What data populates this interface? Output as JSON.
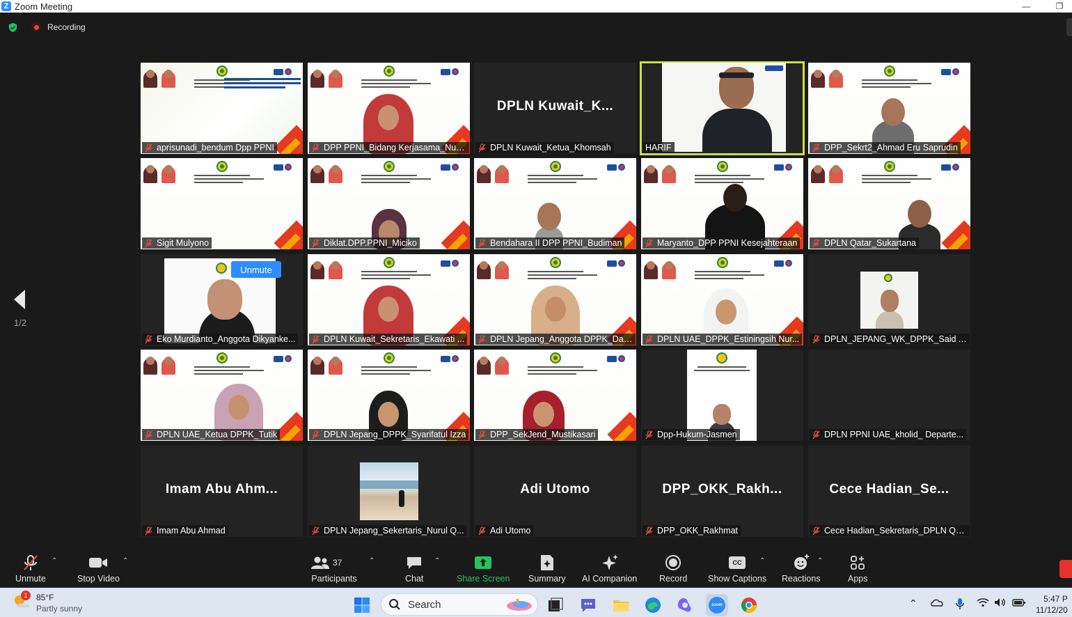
{
  "window": {
    "title": "Zoom Meeting",
    "minimize_glyph": "—",
    "restore_glyph": "❐"
  },
  "status": {
    "recording_label": "Recording"
  },
  "pagination": {
    "page_label": "1/2"
  },
  "tiles": [
    {
      "name": "aprisunadi_bendum Dpp PPNI",
      "kind": "slide-green"
    },
    {
      "name": "DPP PPNI_Bidang Kerjasama_Nuni...",
      "kind": "slide-hijab"
    },
    {
      "name": "DPLN Kuwait_Ketua_Khomsah",
      "kind": "avatar",
      "display": "DPLN  Kuwait_K..."
    },
    {
      "name": "HARIF",
      "kind": "speaker"
    },
    {
      "name": "DPP_Sekrt2_Ahmad Eru Saprudin",
      "kind": "slide-man"
    },
    {
      "name": "Sigit Mulyono",
      "kind": "slide"
    },
    {
      "name": "Diklat.DPP.PPNI_Miciko",
      "kind": "slide-hijab-small"
    },
    {
      "name": "Bendahara II DPP PPNI_Budiman",
      "kind": "slide-man-small"
    },
    {
      "name": "Maryanto_DPP PPNI Kesejahteraan",
      "kind": "slide-dark-face"
    },
    {
      "name": "DPLN Qatar_Sukartana",
      "kind": "slide-man-corner"
    },
    {
      "name": "Eko Murdianto_Anggota Dikyanke...",
      "kind": "unmute-face"
    },
    {
      "name": "DPLN Kuwait_Sekretaris_Ekawati ...",
      "kind": "slide-hijab"
    },
    {
      "name": "DPLN Jepang_Anggota DPPK_Dad...",
      "kind": "slide-hijab-beige"
    },
    {
      "name": "DPLN UAE_DPPK_Estiningsih Nur...",
      "kind": "slide-hijab-white"
    },
    {
      "name": "DPLN_JEPANG_WK_DPPK_Said A...",
      "kind": "small-video"
    },
    {
      "name": "DPLN UAE_Ketua DPPK_Tutik",
      "kind": "slide-hijab-pink"
    },
    {
      "name": "DPLN Jepang_DPPK_Syarifatul Izza",
      "kind": "slide-hijab-black"
    },
    {
      "name": "DPP_SekJend_Mustikasari",
      "kind": "slide-hijab-red"
    },
    {
      "name": "Dpp-Hukum-Jasmen",
      "kind": "portrait-slide"
    },
    {
      "name": "DPLN PPNI UAE_kholid_ Departe...",
      "kind": "empty"
    },
    {
      "name": "Imam Abu Ahmad",
      "kind": "avatar",
      "display": "Imam  Abu  Ahm..."
    },
    {
      "name": "DPLN Jepang_Sekertaris_Nurul Q...",
      "kind": "beach"
    },
    {
      "name": "Adi Utomo",
      "kind": "avatar",
      "display": "Adi Utomo"
    },
    {
      "name": "DPP_OKK_Rakhmat",
      "kind": "avatar",
      "display": "DPP_OKK_Rakh..."
    },
    {
      "name": "Cece Hadian_Sekretaris_DPLN Qat...",
      "kind": "avatar",
      "display": "Cece  Hadian_Se..."
    }
  ],
  "unmute_pill_label": "Unmute",
  "toolbar": {
    "unmute": "Unmute",
    "stop_video": "Stop Video",
    "participants": "Participants",
    "participants_count": "37",
    "chat": "Chat",
    "share_screen": "Share Screen",
    "summary": "Summary",
    "ai_companion": "AI Companion",
    "record": "Record",
    "show_captions": "Show Captions",
    "reactions": "Reactions",
    "apps": "Apps",
    "caption_badge": "CC"
  },
  "taskbar": {
    "weather_temp": "85°F",
    "weather_desc": "Partly sunny",
    "weather_badge": "1",
    "search_label": "Search",
    "time": "5:47 P",
    "date": "11/12/20"
  },
  "colors": {
    "zoom_blue": "#2d8cff",
    "share_green": "#22c55e",
    "speaker_outline": "#c8e23a",
    "mute_red": "#e24b3f"
  }
}
